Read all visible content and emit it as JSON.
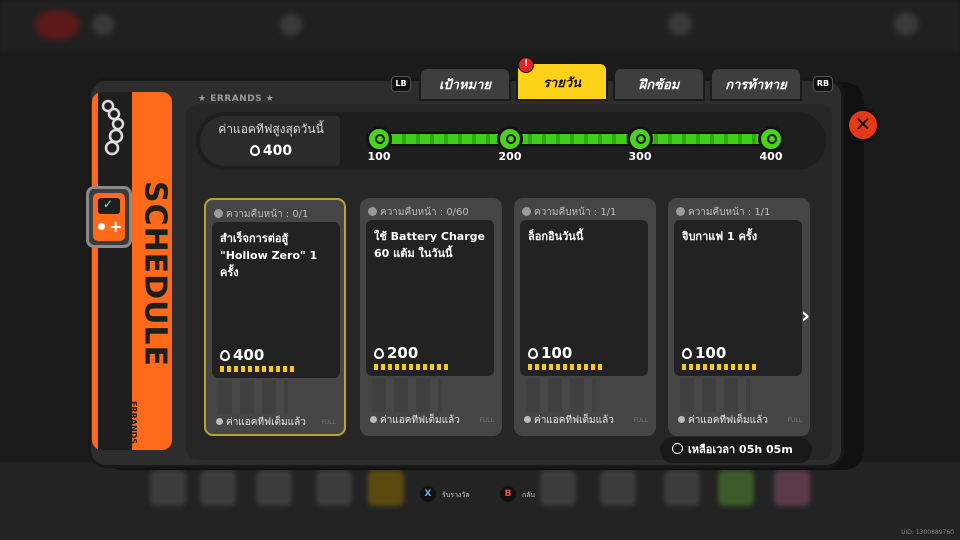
{
  "errands_label": "★ ERRANDS ★",
  "strip_text": "SCHEDULE",
  "strip_sub": "ERRANDS",
  "tabs": {
    "lb": "LB",
    "rb": "RB",
    "items": [
      {
        "label": "เป้าหมาย",
        "active": false
      },
      {
        "label": "รายวัน",
        "active": true
      },
      {
        "label": "ฝึกซ้อม",
        "active": false
      },
      {
        "label": "การท้าทาย",
        "active": false
      }
    ],
    "alert": "!"
  },
  "daily_activity": {
    "label": "ค่าแอคทีฟสูงสุดวันนี้",
    "value": "400",
    "progress_fraction": 1.0,
    "milestones": [
      "100",
      "200",
      "300",
      "400"
    ]
  },
  "cards": [
    {
      "progress": "ความคืบหน้า : 0/1",
      "title": "สำเร็จการต่อสู้ \"Hollow Zero\" 1 ครั้ง",
      "reward": "400",
      "status": "ค่าแอคทีฟเต็มแล้ว",
      "tag": "FULL"
    },
    {
      "progress": "ความคืบหน้า : 0/60",
      "title": "ใช้ Battery Charge 60 แต้ม ในวันนี้",
      "reward": "200",
      "status": "ค่าแอคทีฟเต็มแล้ว",
      "tag": "FULL"
    },
    {
      "progress": "ความคืบหน้า : 1/1",
      "title": "ล็อกอินวันนี้",
      "reward": "100",
      "status": "ค่าแอคทีฟเต็มแล้ว",
      "tag": "FULL"
    },
    {
      "progress": "ความคืบหน้า : 1/1",
      "title": "จิบกาแฟ 1 ครั้ง",
      "reward": "100",
      "status": "ค่าแอคทีฟเต็มแล้ว",
      "tag": "FULL"
    }
  ],
  "timer": "เหลือเวลา 05h 05m",
  "close": "✕",
  "next_arrow": "›",
  "hints": {
    "x_key": "X",
    "x_label": "รับรางวัล",
    "b_key": "B",
    "b_label": "กลับ"
  },
  "uid": "UID: 1300889760",
  "colors": {
    "accent_orange": "#ff6a1a",
    "active_tab": "#ffd21a",
    "progress_green": "#3ecf1a",
    "close_red": "#e53a1a"
  }
}
